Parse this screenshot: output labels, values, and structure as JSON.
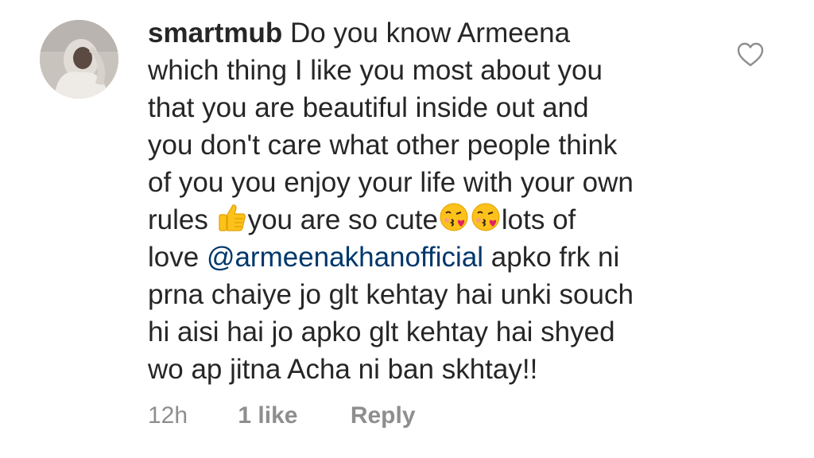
{
  "comment": {
    "username": "smartmub",
    "lines": [
      "Do you know Armeena",
      "which thing I like you most about you",
      "that you are beautiful inside out and",
      "you don't care what other people think",
      "of you you enjoy your life with your own"
    ],
    "line6": {
      "before_thumb": "rules ",
      "after_thumb": "you are so cute",
      "after_kisses": "lots of"
    },
    "line7": {
      "before_mention": "love ",
      "mention": "@armeenakhanofficial",
      "after_mention": " apko frk ni"
    },
    "tail_lines": [
      "prna chaiye jo glt kehtay hai unki souch",
      "hi aisi hai jo apko glt kehtay hai shyed",
      "wo ap jitna Acha ni ban skhtay!!"
    ],
    "emojis": [
      "thumbs-up",
      "face-blowing-kiss",
      "face-blowing-kiss"
    ]
  },
  "meta": {
    "time": "12h",
    "likes": "1 like",
    "reply": "Reply"
  },
  "icons": {
    "like": "heart-outline-icon",
    "avatar": "profile-avatar"
  },
  "colors": {
    "text": "#262626",
    "mention": "#00376b",
    "secondary": "#8e8e8e"
  }
}
